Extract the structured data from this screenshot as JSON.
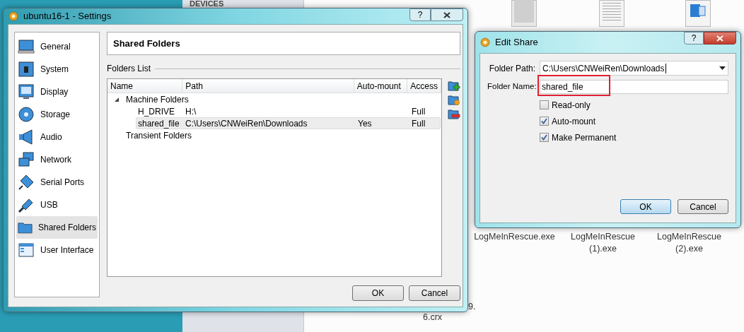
{
  "desktop": {
    "sidebar_heading": "DEVICES",
    "files": [
      {
        "label": "LogMeInRescue.exe",
        "kind": "image"
      },
      {
        "label": "LogMeInRescue\n(1).exe",
        "kind": "text"
      },
      {
        "label": "LogMeInRescue\n(2).exe",
        "kind": "word"
      }
    ],
    "partial_labels": [
      "9.",
      "6.crx"
    ]
  },
  "settings_window": {
    "title": "ubuntu16-1 - Settings",
    "title_buttons": [
      "?"
    ],
    "nav": [
      {
        "label": "General",
        "selected": false
      },
      {
        "label": "System",
        "selected": false
      },
      {
        "label": "Display",
        "selected": false
      },
      {
        "label": "Storage",
        "selected": false
      },
      {
        "label": "Audio",
        "selected": false
      },
      {
        "label": "Network",
        "selected": false
      },
      {
        "label": "Serial Ports",
        "selected": false
      },
      {
        "label": "USB",
        "selected": false
      },
      {
        "label": "Shared Folders",
        "selected": true
      },
      {
        "label": "User Interface",
        "selected": false
      }
    ],
    "page_title": "Shared Folders",
    "section_label": "Folders List",
    "table": {
      "columns": [
        "Name",
        "Path",
        "Auto-mount",
        "Access"
      ],
      "groups": [
        {
          "name": "Machine Folders",
          "expanded": true,
          "children": [
            {
              "name": "H_DRIVE",
              "path": "H:\\",
              "access": "Full",
              "selected": false
            },
            {
              "name": "shared_file",
              "path": "C:\\Users\\CNWeiRen\\Downloads",
              "auto_mount": "Yes",
              "access": "Full",
              "selected": true
            }
          ]
        },
        {
          "name": "Transient Folders",
          "expanded": false
        }
      ]
    },
    "buttons": [
      "OK",
      "Cancel"
    ]
  },
  "edit_share": {
    "title": "Edit Share",
    "title_buttons": [
      "?"
    ],
    "folder_path": {
      "label": "Folder Path:",
      "value": "C:\\Users\\CNWeiRen\\Downloads"
    },
    "folder_name": {
      "label": "Folder Name:",
      "value": "shared_file",
      "highlighted": true
    },
    "options": [
      {
        "label": "Read-only",
        "checked": false
      },
      {
        "label": "Auto-mount",
        "checked": true
      },
      {
        "label": "Make Permanent",
        "checked": true
      }
    ],
    "buttons": [
      {
        "label": "OK",
        "default": true
      },
      {
        "label": "Cancel",
        "default": false
      }
    ]
  }
}
